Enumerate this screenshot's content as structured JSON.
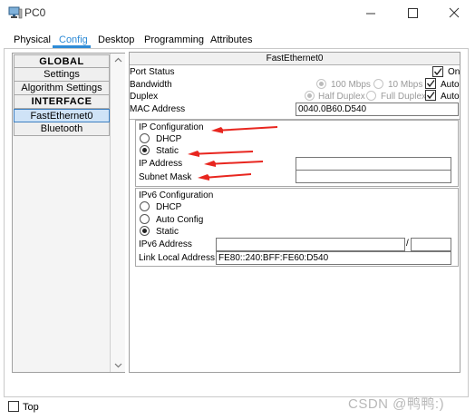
{
  "window": {
    "title": "PC0",
    "icons": {
      "app": "pc-icon",
      "minimize": "minimize-icon",
      "maximize": "maximize-icon",
      "close": "close-icon"
    }
  },
  "tabs": [
    {
      "label": "Physical",
      "active": false
    },
    {
      "label": "Config",
      "active": true
    },
    {
      "label": "Desktop",
      "active": false
    },
    {
      "label": "Programming",
      "active": false
    },
    {
      "label": "Attributes",
      "active": false
    }
  ],
  "sidebar": {
    "items": [
      {
        "label": "GLOBAL",
        "type": "header"
      },
      {
        "label": "Settings",
        "type": "item"
      },
      {
        "label": "Algorithm Settings",
        "type": "item"
      },
      {
        "label": "INTERFACE",
        "type": "header"
      },
      {
        "label": "FastEthernet0",
        "type": "item",
        "selected": true
      },
      {
        "label": "Bluetooth",
        "type": "item"
      }
    ]
  },
  "panel": {
    "title": "FastEthernet0",
    "port_status": {
      "label": "Port Status",
      "on_label": "On",
      "on_checked": true
    },
    "bandwidth": {
      "label": "Bandwidth",
      "opt1": "100 Mbps",
      "opt2": "10 Mbps",
      "auto_label": "Auto",
      "auto_checked": true,
      "selected": "100 Mbps"
    },
    "duplex": {
      "label": "Duplex",
      "opt1": "Half Duplex",
      "opt2": "Full Duplex",
      "auto_label": "Auto",
      "auto_checked": true,
      "selected": "Half Duplex"
    },
    "mac": {
      "label": "MAC Address",
      "value": "0040.0B60.D540"
    },
    "ip_config": {
      "heading": "IP Configuration",
      "dhcp_label": "DHCP",
      "static_label": "Static",
      "selected": "Static",
      "ip_label": "IP Address",
      "ip_value": "",
      "mask_label": "Subnet Mask",
      "mask_value": ""
    },
    "ipv6_config": {
      "heading": "IPv6 Configuration",
      "dhcp_label": "DHCP",
      "auto_label": "Auto Config",
      "static_label": "Static",
      "selected": "Static",
      "addr_label": "IPv6 Address",
      "addr_value": "",
      "prefix_separator": "/",
      "prefix_value": "",
      "link_local_label": "Link Local Address:",
      "link_local_value": "FE80::240:BFF:FE60:D540"
    }
  },
  "footer": {
    "top_label": "Top",
    "top_checked": false
  },
  "watermark": "CSDN @鸭鸭:)",
  "colors": {
    "accent": "#2e8bd6",
    "annotation_arrow": "#e8261f",
    "selected_bg": "#cfe3f7"
  }
}
